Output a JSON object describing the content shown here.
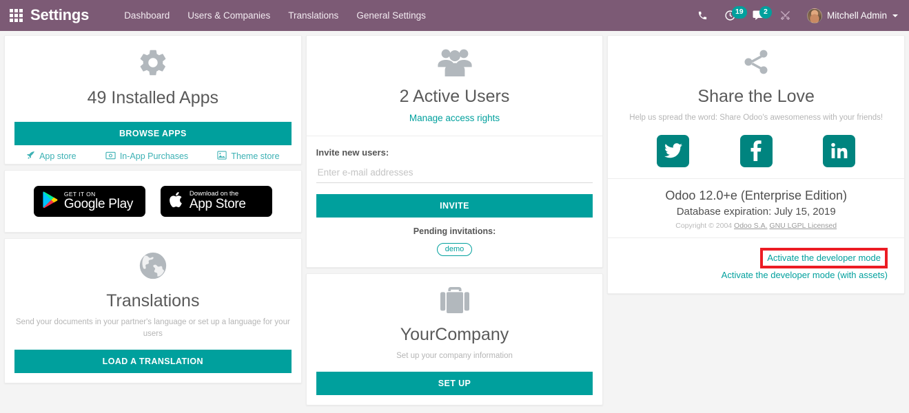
{
  "navbar": {
    "apps_icon": "apps-grid-icon",
    "brand": "Settings",
    "menus": [
      {
        "label": "Dashboard"
      },
      {
        "label": "Users & Companies"
      },
      {
        "label": "Translations"
      },
      {
        "label": "General Settings"
      }
    ],
    "icons": [
      {
        "name": "phone-icon",
        "badge": ""
      },
      {
        "name": "clock-activity-icon",
        "badge": "19"
      },
      {
        "name": "chat-messages-icon",
        "badge": "2"
      },
      {
        "name": "tools-wrench-icon",
        "badge": ""
      }
    ],
    "user": {
      "name": "Mitchell Admin",
      "avatar": "user-avatar"
    },
    "accent_color": "#7c5a75",
    "badge_color": "#00a09d"
  },
  "apps_card": {
    "icon": "gear-icon",
    "title": "49 Installed Apps",
    "browse_button": "BROWSE APPS",
    "links": [
      {
        "label": "App store",
        "icon": "rocket-icon"
      },
      {
        "label": "In-App Purchases",
        "icon": "money-bill-icon"
      },
      {
        "label": "Theme store",
        "icon": "image-icon"
      }
    ]
  },
  "mobile_card": {
    "google_play": {
      "small": "GET IT ON",
      "big": "Google Play",
      "icon": "google-play-icon"
    },
    "app_store": {
      "small": "Download on the",
      "big": "App Store",
      "icon": "apple-icon"
    }
  },
  "translations_card": {
    "icon": "globe-icon",
    "title": "Translations",
    "subtitle": "Send your documents in your partner's language or set up a language for your users",
    "button": "LOAD A TRANSLATION"
  },
  "users_card": {
    "icon": "users-group-icon",
    "title": "2 Active Users",
    "manage_link": "Manage access rights",
    "invite_label": "Invite new users:",
    "email_placeholder": "Enter e-mail addresses",
    "email_value": "",
    "invite_button": "INVITE",
    "pending_label": "Pending invitations:",
    "pending": [
      {
        "label": "demo"
      }
    ]
  },
  "company_card": {
    "icon": "briefcase-icon",
    "title": "YourCompany",
    "subtitle": "Set up your company information",
    "button": "SET UP"
  },
  "share_card": {
    "icon": "share-nodes-icon",
    "title": "Share the Love",
    "subtitle": "Help us spread the word: Share Odoo's awesomeness with your friends!",
    "socials": [
      {
        "name": "twitter-icon"
      },
      {
        "name": "facebook-icon"
      },
      {
        "name": "linkedin-icon"
      }
    ],
    "social_color": "#00847f"
  },
  "version_card": {
    "version": "Odoo 12.0+e (Enterprise Edition)",
    "expiration": "Database expiration: July 15, 2019",
    "copyright_prefix": "Copyright © 2004 ",
    "copyright_links": [
      {
        "label": "Odoo S.A."
      },
      {
        "label": "GNU LGPL Licensed"
      }
    ],
    "developer_mode": "Activate the developer mode",
    "developer_mode_assets": "Activate the developer mode (with assets)",
    "highlight_color": "#ec1c24"
  }
}
